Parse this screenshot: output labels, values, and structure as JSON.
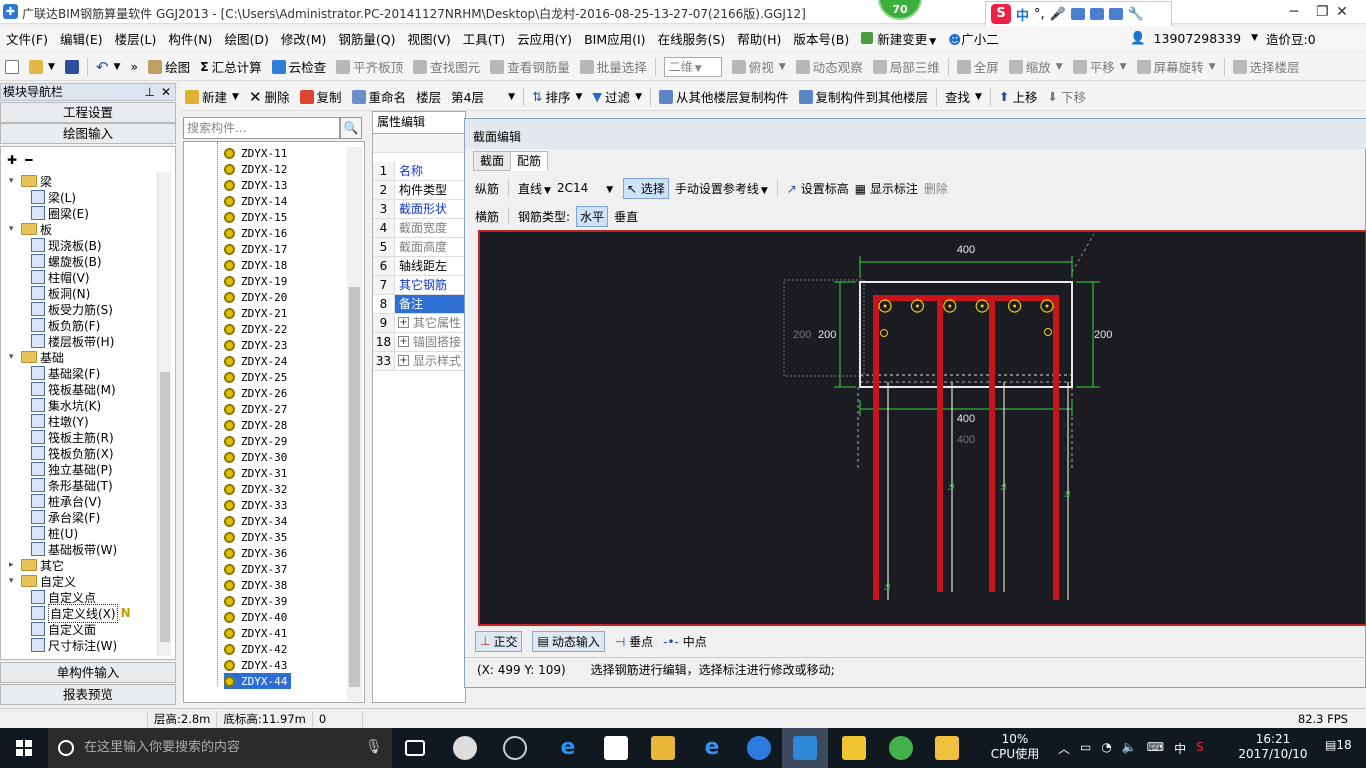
{
  "window": {
    "title": "广联达BIM钢筋算量软件 GGJ2013 - [C:\\Users\\Administrator.PC-20141127NRHM\\Desktop\\白龙村-2016-08-25-13-27-07(2166版).GGJ12]",
    "badge": "70",
    "ime": {
      "brand": "S",
      "mode": "中",
      "punct": "°,"
    }
  },
  "menu": {
    "items": [
      "文件(F)",
      "编辑(E)",
      "楼层(L)",
      "构件(N)",
      "绘图(D)",
      "修改(M)",
      "钢筋量(Q)",
      "视图(V)",
      "工具(T)",
      "云应用(Y)",
      "BIM应用(I)",
      "在线服务(S)",
      "帮助(H)",
      "版本号(B)",
      "新建变更",
      "广小二"
    ],
    "phone": "13907298339",
    "price": "造价豆:0"
  },
  "toolbar1": {
    "draw": "绘图",
    "sum": "汇总计算",
    "cloud_check": "云检查",
    "flush": "平齐板顶",
    "find": "查找图元",
    "view_rebar": "查看钢筋量",
    "batch": "批量选择",
    "dim": "二维",
    "plan": "俯视",
    "orbit": "动态观察",
    "local3d": "局部三维",
    "fullscreen": "全屏",
    "zoom": "缩放",
    "pan": "平移",
    "rotate": "屏幕旋转",
    "select_floor": "选择楼层"
  },
  "toolbar2": {
    "new": "新建",
    "delete": "删除",
    "copy": "复制",
    "rename": "重命名",
    "floor_label": "楼层",
    "floor_value": "第4层",
    "sort": "排序",
    "filter": "过滤",
    "copy_from": "从其他楼层复制构件",
    "copy_to": "复制构件到其他楼层",
    "find": "查找",
    "up": "上移",
    "down": "下移"
  },
  "nav": {
    "header": "模块导航栏",
    "project_settings": "工程设置",
    "drawing_input": "绘图输入",
    "single_input": "单构件输入",
    "report": "报表预览",
    "tree": [
      {
        "label": "梁",
        "level": 0,
        "folder": true,
        "expanded": true
      },
      {
        "label": "梁(L)",
        "level": 1
      },
      {
        "label": "圈梁(E)",
        "level": 1
      },
      {
        "label": "板",
        "level": 0,
        "folder": true,
        "expanded": true
      },
      {
        "label": "现浇板(B)",
        "level": 1
      },
      {
        "label": "螺旋板(B)",
        "level": 1
      },
      {
        "label": "柱帽(V)",
        "level": 1
      },
      {
        "label": "板洞(N)",
        "level": 1
      },
      {
        "label": "板受力筋(S)",
        "level": 1
      },
      {
        "label": "板负筋(F)",
        "level": 1
      },
      {
        "label": "楼层板带(H)",
        "level": 1
      },
      {
        "label": "基础",
        "level": 0,
        "folder": true,
        "expanded": true
      },
      {
        "label": "基础梁(F)",
        "level": 1
      },
      {
        "label": "筏板基础(M)",
        "level": 1
      },
      {
        "label": "集水坑(K)",
        "level": 1
      },
      {
        "label": "柱墩(Y)",
        "level": 1
      },
      {
        "label": "筏板主筋(R)",
        "level": 1
      },
      {
        "label": "筏板负筋(X)",
        "level": 1
      },
      {
        "label": "独立基础(P)",
        "level": 1
      },
      {
        "label": "条形基础(T)",
        "level": 1
      },
      {
        "label": "桩承台(V)",
        "level": 1
      },
      {
        "label": "承台梁(F)",
        "level": 1
      },
      {
        "label": "桩(U)",
        "level": 1
      },
      {
        "label": "基础板带(W)",
        "level": 1
      },
      {
        "label": "其它",
        "level": 0,
        "folder": true,
        "expanded": false
      },
      {
        "label": "自定义",
        "level": 0,
        "folder": true,
        "expanded": true
      },
      {
        "label": "自定义点",
        "level": 1
      },
      {
        "label": "自定义线(X)",
        "level": 1,
        "selected": true,
        "tag": "N"
      },
      {
        "label": "自定义面",
        "level": 1
      },
      {
        "label": "尺寸标注(W)",
        "level": 1
      }
    ]
  },
  "components": {
    "search_placeholder": "搜索构件...",
    "items": [
      "ZDYX-11",
      "ZDYX-12",
      "ZDYX-13",
      "ZDYX-14",
      "ZDYX-15",
      "ZDYX-16",
      "ZDYX-17",
      "ZDYX-18",
      "ZDYX-19",
      "ZDYX-20",
      "ZDYX-21",
      "ZDYX-22",
      "ZDYX-23",
      "ZDYX-24",
      "ZDYX-25",
      "ZDYX-26",
      "ZDYX-27",
      "ZDYX-28",
      "ZDYX-29",
      "ZDYX-30",
      "ZDYX-31",
      "ZDYX-32",
      "ZDYX-33",
      "ZDYX-34",
      "ZDYX-35",
      "ZDYX-36",
      "ZDYX-37",
      "ZDYX-38",
      "ZDYX-39",
      "ZDYX-40",
      "ZDYX-41",
      "ZDYX-42",
      "ZDYX-43",
      "ZDYX-44"
    ],
    "selected": "ZDYX-44"
  },
  "properties": {
    "tab": "属性编辑",
    "rows": [
      {
        "num": "1",
        "name": "名称",
        "style": "blue"
      },
      {
        "num": "2",
        "name": "构件类型",
        "style": "normal"
      },
      {
        "num": "3",
        "name": "截面形状",
        "style": "blue"
      },
      {
        "num": "4",
        "name": "截面宽度",
        "style": "gray"
      },
      {
        "num": "5",
        "name": "截面高度",
        "style": "gray"
      },
      {
        "num": "6",
        "name": "轴线距左",
        "style": "normal"
      },
      {
        "num": "7",
        "name": "其它钢筋",
        "style": "blue"
      },
      {
        "num": "8",
        "name": "备注",
        "style": "normal",
        "selected": true
      },
      {
        "num": "9",
        "name": "其它属性",
        "style": "gray",
        "expandable": true
      },
      {
        "num": "18",
        "name": "锚固搭接",
        "style": "gray",
        "expandable": true
      },
      {
        "num": "33",
        "name": "显示样式",
        "style": "gray",
        "expandable": true
      }
    ]
  },
  "dialog": {
    "title": "截面编辑",
    "tabs": [
      "截面",
      "配筋"
    ],
    "active_tab": "配筋",
    "long_bar": "纵筋",
    "line_mode": "直线",
    "spec": "2C14",
    "select": "选择",
    "manual_ref": "手动设置参考线",
    "set_elev": "设置标高",
    "show_label": "显示标注",
    "delete": "删除",
    "stirrup": "横筋",
    "rebar_type_label": "钢筋类型:",
    "horizontal": "水平",
    "vertical": "垂直",
    "ortho": "正交",
    "dynamic_input": "动态输入",
    "perp_point": "垂点",
    "mid_point": "中点",
    "coords": "(X: 499 Y: 109)",
    "hint": "选择钢筋进行编辑，选择标注进行修改或移动;",
    "drawing": {
      "top_width": "400",
      "bottom_width": "400",
      "bottom_width_ghost": "400",
      "left_height": "200",
      "left_height_ghost": "200",
      "right_height": "200",
      "label_la": "la",
      "bar_count": 6
    }
  },
  "status": {
    "floor_height": "层高:2.8m",
    "base_elev": "底标高:11.97m",
    "zero": "0",
    "fps": "82.3 FPS"
  },
  "taskbar": {
    "search_placeholder": "在这里输入你要搜索的内容",
    "cpu_percent": "10%",
    "cpu_label": "CPU使用",
    "lang": "中",
    "time": "16:21",
    "date": "2017/10/10",
    "notifications": "18"
  },
  "colors": {
    "canvas_bg": "#1b1b22",
    "rebar_red": "#c8151c",
    "dim_green": "#3fd43f",
    "selection_blue": "#2e6fd3"
  }
}
